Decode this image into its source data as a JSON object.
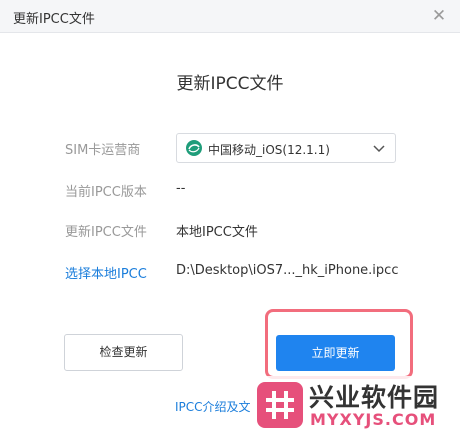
{
  "window": {
    "title": "更新IPCC文件",
    "close_glyph": "✕"
  },
  "heading": "更新IPCC文件",
  "form": {
    "carrier_label": "SIM卡运营商",
    "carrier_value": "中国移动_iOS(12.1.1)",
    "current_version_label": "当前IPCC版本",
    "current_version_value": "--",
    "update_file_label": "更新IPCC文件",
    "update_file_value": "本地IPCC文件",
    "choose_local_label": "选择本地IPCC",
    "choose_local_path": "D:\\Desktop\\iOS7..._hk_iPhone.ipcc"
  },
  "buttons": {
    "check": "检查更新",
    "update_now": "立即更新"
  },
  "footer": {
    "link": "IPCC介绍及文"
  },
  "watermark": {
    "top": "兴业软件园",
    "bottom": "MYXYJS.COM"
  },
  "colors": {
    "accent": "#1f84ef",
    "link": "#1a7ddb",
    "highlight": "#f26d7d",
    "watermark": "#e6507b"
  }
}
